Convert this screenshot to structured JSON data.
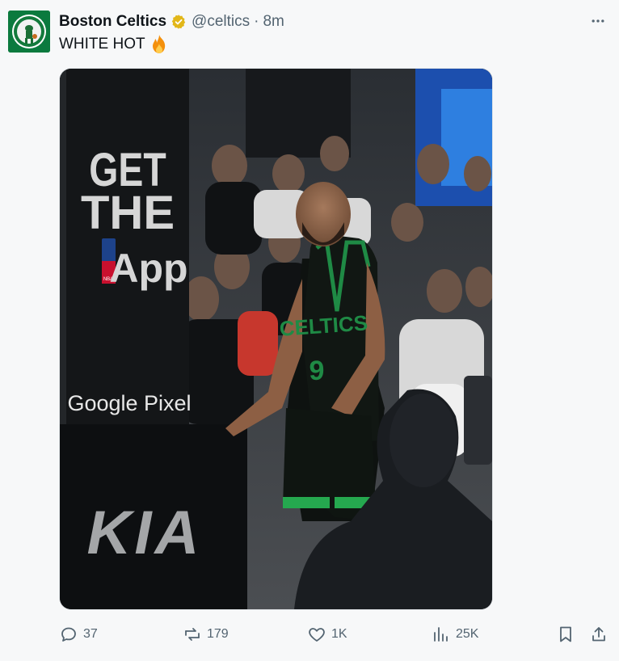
{
  "post": {
    "author_name": "Boston Celtics",
    "handle": "@celtics",
    "separator": "·",
    "time": "8m",
    "text": "WHITE HOT",
    "emoji": "fire",
    "verified": true
  },
  "media": {
    "signage": {
      "get": "GET",
      "the": "THE",
      "app": "App",
      "nba": "NBA",
      "google_pixel": "Google Pixel",
      "kia": "KIA"
    },
    "jersey": {
      "team": "CELTICS",
      "number": "9"
    }
  },
  "actions": {
    "replies": "37",
    "reposts": "179",
    "likes": "1K",
    "views": "25K"
  },
  "icons": [
    "celtics-logo-icon",
    "verified-badge-icon",
    "more-icon",
    "fire-icon",
    "reply-icon",
    "repost-icon",
    "like-icon",
    "views-icon",
    "bookmark-icon",
    "share-icon"
  ],
  "colors": {
    "text": "#0f1419",
    "muted": "#536471",
    "verified": "#e2b719",
    "celtics_green": "#007a33"
  }
}
